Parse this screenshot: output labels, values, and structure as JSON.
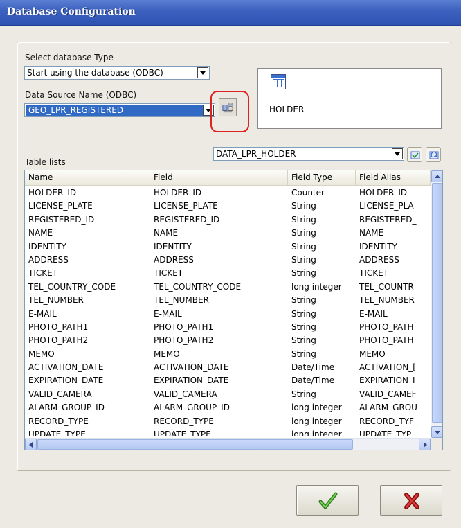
{
  "window": {
    "title": "Database Configuration"
  },
  "db_type": {
    "label": "Select database Type",
    "selected": "Start using the database (ODBC)"
  },
  "dsn": {
    "label": "Data Source Name (ODBC)",
    "selected": "GEO_LPR_REGISTERED",
    "connect_icon": "database-connect-icon"
  },
  "preview": {
    "icon": "table-grid-icon",
    "name": "HOLDER"
  },
  "table_lists": {
    "label": "Table lists",
    "selected": "DATA_LPR_HOLDER",
    "check_icon": "check-table-icon",
    "refresh_icon": "refresh-table-icon"
  },
  "fields_list": {
    "columns": [
      "Name",
      "Field",
      "Field Type",
      "Field Alias"
    ],
    "rows": [
      [
        "HOLDER_ID",
        "HOLDER_ID",
        "Counter",
        "HOLDER_ID"
      ],
      [
        "LICENSE_PLATE",
        "LICENSE_PLATE",
        "String",
        "LICENSE_PLA"
      ],
      [
        "REGISTERED_ID",
        "REGISTERED_ID",
        "String",
        "REGISTERED_"
      ],
      [
        "NAME",
        "NAME",
        "String",
        "NAME"
      ],
      [
        "IDENTITY",
        "IDENTITY",
        "String",
        "IDENTITY"
      ],
      [
        "ADDRESS",
        "ADDRESS",
        "String",
        "ADDRESS"
      ],
      [
        "TICKET",
        "TICKET",
        "String",
        "TICKET"
      ],
      [
        "TEL_COUNTRY_CODE",
        "TEL_COUNTRY_CODE",
        "long integer",
        "TEL_COUNTR"
      ],
      [
        "TEL_NUMBER",
        "TEL_NUMBER",
        "String",
        "TEL_NUMBER"
      ],
      [
        "E-MAIL",
        "E-MAIL",
        "String",
        "E-MAIL"
      ],
      [
        "PHOTO_PATH1",
        "PHOTO_PATH1",
        "String",
        "PHOTO_PATH"
      ],
      [
        "PHOTO_PATH2",
        "PHOTO_PATH2",
        "String",
        "PHOTO_PATH"
      ],
      [
        "MEMO",
        "MEMO",
        "String",
        "MEMO"
      ],
      [
        "ACTIVATION_DATE",
        "ACTIVATION_DATE",
        "Date/Time",
        "ACTIVATION_["
      ],
      [
        "EXPIRATION_DATE",
        "EXPIRATION_DATE",
        "Date/Time",
        "EXPIRATION_I"
      ],
      [
        "VALID_CAMERA",
        "VALID_CAMERA",
        "String",
        "VALID_CAMEF"
      ],
      [
        "ALARM_GROUP_ID",
        "ALARM_GROUP_ID",
        "long integer",
        "ALARM_GROU"
      ],
      [
        "RECORD_TYPE",
        "RECORD_TYPE",
        "long integer",
        "RECORD_TYF"
      ],
      [
        "UPDATE_TYPE",
        "UPDATE_TYPE",
        "long integer",
        "UPDATE_TYP"
      ]
    ]
  },
  "buttons": {
    "ok_icon": "green-checkmark-icon",
    "cancel_icon": "red-x-icon"
  }
}
